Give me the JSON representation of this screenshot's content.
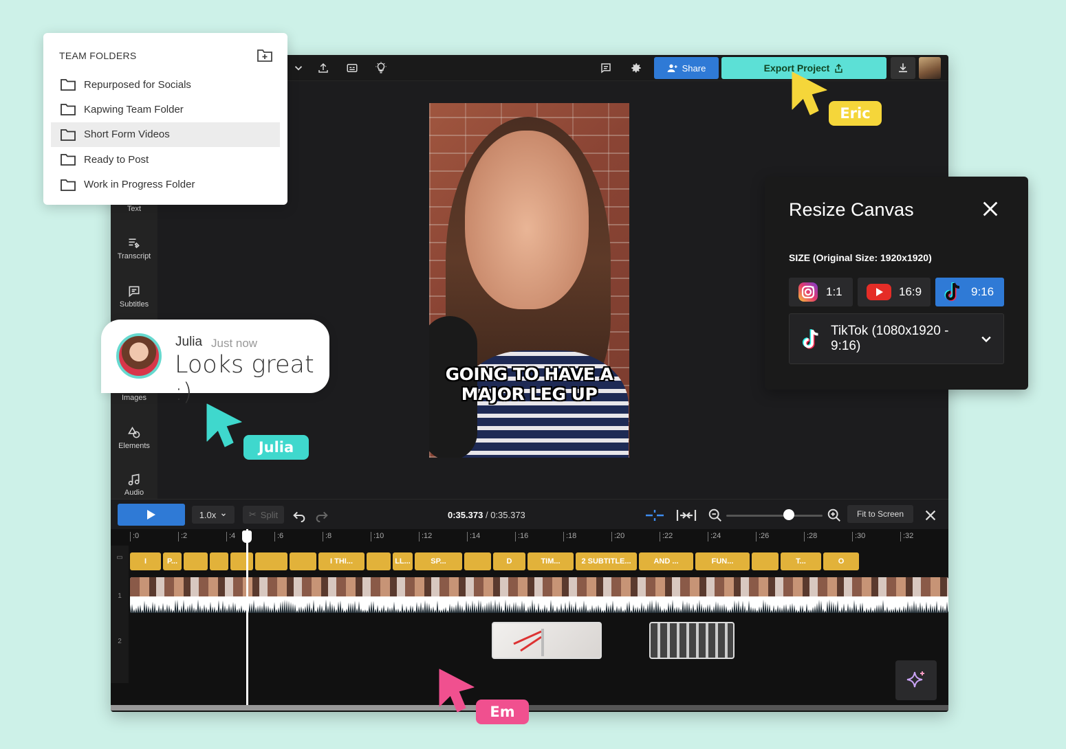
{
  "folders": {
    "title": "TEAM FOLDERS",
    "items": [
      "Repurposed for Socials",
      "Kapwing Team Folder",
      "Short Form Videos",
      "Ready to Post",
      "Work in Progress Folder"
    ],
    "selected_index": 2
  },
  "toolbar": {
    "share_label": "Share",
    "export_label": "Export Project"
  },
  "sidebar": {
    "items": [
      "Text",
      "Transcript",
      "Subtitles",
      "Images",
      "Elements",
      "Audio"
    ]
  },
  "video": {
    "caption": "GOING TO HAVE A MAJOR LEG UP"
  },
  "comment": {
    "author": "Julia",
    "time": "Just now",
    "text": "Looks great :)"
  },
  "resize": {
    "title": "Resize Canvas",
    "size_label": "SIZE (Original Size: 1920x1920)",
    "ratios": [
      {
        "label": "1:1",
        "icon": "instagram-icon"
      },
      {
        "label": "16:9",
        "icon": "youtube-icon"
      },
      {
        "label": "9:16",
        "icon": "tiktok-icon"
      }
    ],
    "active_ratio": "9:16",
    "preset": "TikTok (1080x1920 - 9:16)"
  },
  "controls": {
    "speed": "1.0x",
    "split_label": "Split",
    "current_time": "0:35.373",
    "total_time": "0:35.373",
    "fit_label": "Fit to Screen",
    "zoom_level": 0.65
  },
  "timeline": {
    "ticks": [
      ":0",
      ":2",
      ":4",
      ":6",
      ":8",
      ":10",
      ":12",
      ":14",
      ":16",
      ":18",
      ":20",
      ":22",
      ":24",
      ":26",
      ":28",
      ":30",
      ":32"
    ],
    "subtitle_clips": [
      "I",
      "P...",
      "",
      "",
      "",
      "",
      "",
      "I THI...",
      "",
      "LL...",
      "SP...",
      "",
      "D",
      "TIM...",
      "2 SUBTITLE...",
      "AND ...",
      "FUN...",
      "",
      "T...",
      "O"
    ],
    "track_numbers": [
      "1",
      "2"
    ]
  },
  "cursors": [
    {
      "name": "Eric",
      "color": "#f5d63a"
    },
    {
      "name": "Julia",
      "color": "#3fd8cd"
    },
    {
      "name": "Em",
      "color": "#f0508f"
    }
  ],
  "colors": {
    "accent_blue": "#2f7ad6",
    "export_teal": "#5ce0d6",
    "subtitle_yellow": "#e2b23a",
    "background": "#cdf1e8"
  }
}
